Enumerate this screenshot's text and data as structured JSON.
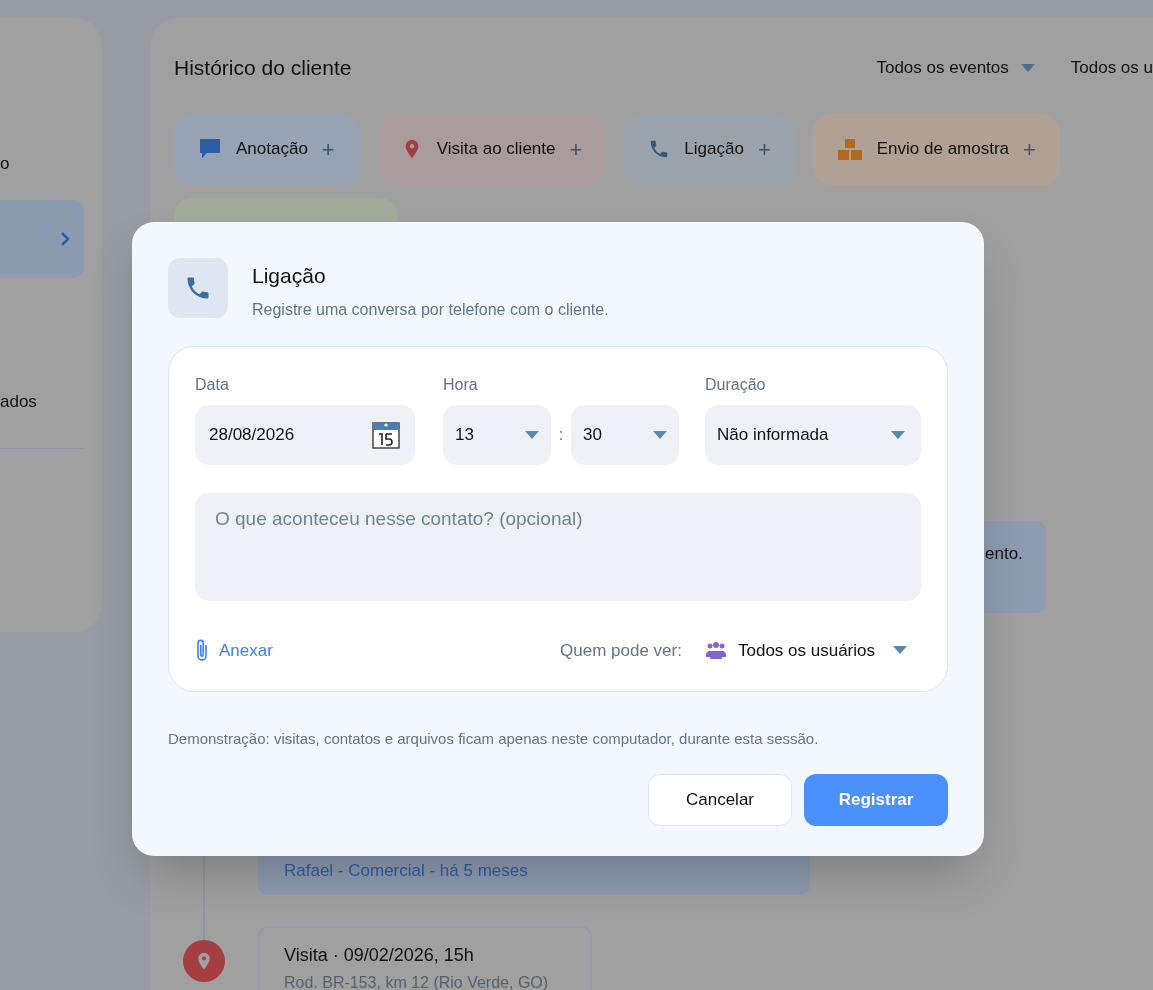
{
  "sidebar": {
    "items": [
      {
        "label": "o",
        "selected": false
      },
      {
        "selected": true
      },
      {
        "label": "ados",
        "selected": false
      }
    ]
  },
  "history": {
    "title": "Histórico do cliente",
    "filters": [
      {
        "label": "Todos os eventos",
        "dropdown": true
      },
      {
        "label": "Todos os u",
        "dropdown": false
      }
    ],
    "actions": [
      {
        "kind": "note",
        "label": "Anotação",
        "plus": "+",
        "color": "#97a3b3"
      },
      {
        "kind": "visit",
        "label": "Visita ao cliente",
        "plus": "+",
        "color": "#aa9b9c"
      },
      {
        "kind": "call",
        "label": "Ligação",
        "plus": "+",
        "color": "#9aa2ab"
      },
      {
        "kind": "sample",
        "label": "Envio de amostra",
        "plus": "+",
        "color": "#b1a194"
      },
      {
        "kind": "other",
        "color": "#a2ab9b"
      }
    ],
    "events": [
      {
        "kind": "note",
        "text": "ento."
      },
      {
        "kind": "call",
        "meta": "Rafael - Comercial - há 5 meses"
      },
      {
        "kind": "visit",
        "title": "Visita · 09/02/2026, 15h",
        "subtitle": "Rod. BR-153, km 12 (Rio Verde, GO)"
      }
    ]
  },
  "dialog": {
    "title": "Ligação",
    "subtitle": "Registre uma conversa por telefone com o cliente.",
    "date": {
      "label": "Data",
      "value": "28/08/2026"
    },
    "time": {
      "label": "Hora",
      "hour": "13",
      "separator": ":",
      "minute": "30"
    },
    "duration": {
      "label": "Duração",
      "value": "Não informada"
    },
    "notes": {
      "placeholder": "O que aconteceu nesse contato? (opcional)"
    },
    "attach": "Anexar",
    "visibility": {
      "label": "Quem pode ver:",
      "value": "Todos os usuários"
    },
    "notice": "Demonstração: visitas, contatos e arquivos ficam apenas neste computador, durante esta sessão.",
    "buttons": [
      {
        "kind": "secondary",
        "label": "Cancelar"
      },
      {
        "kind": "primary",
        "label": "Registrar"
      }
    ]
  }
}
